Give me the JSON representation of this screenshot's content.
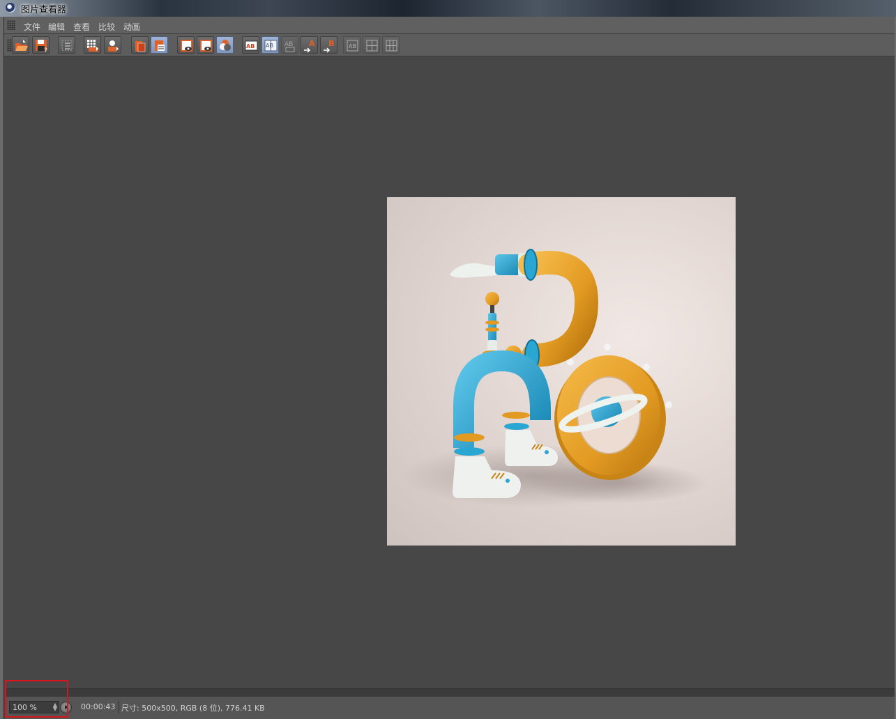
{
  "window": {
    "title": "图片查看器"
  },
  "menu": {
    "items": [
      "文件",
      "编辑",
      "查看",
      "比较",
      "动画"
    ]
  },
  "toolbar": {
    "buttons": [
      {
        "name": "open-file-icon",
        "state": "normal"
      },
      {
        "name": "save-file-icon",
        "state": "normal"
      },
      {
        "name": "filter-icon",
        "state": "normal"
      },
      {
        "name": "grid-export-icon",
        "state": "normal"
      },
      {
        "name": "user-export-icon",
        "state": "normal"
      },
      {
        "name": "copy-layer-icon",
        "state": "normal"
      },
      {
        "name": "layer-stack-icon",
        "state": "active"
      },
      {
        "name": "view-a-icon",
        "state": "normal"
      },
      {
        "name": "view-b-icon",
        "state": "normal"
      },
      {
        "name": "channels-icon",
        "state": "active"
      },
      {
        "name": "ab-compare-icon",
        "state": "normal"
      },
      {
        "name": "ab-split-icon",
        "state": "active"
      },
      {
        "name": "ab-swap-icon",
        "state": "dim"
      },
      {
        "name": "set-a-icon",
        "state": "normal",
        "label": "A"
      },
      {
        "name": "set-b-icon",
        "state": "normal",
        "label": "B"
      },
      {
        "name": "layout-one-icon",
        "state": "dim"
      },
      {
        "name": "layout-two-icon",
        "state": "dim"
      },
      {
        "name": "layout-four-icon",
        "state": "dim"
      }
    ],
    "accent_color": "#e0602a",
    "active_color": "#8ea3c9"
  },
  "viewer": {
    "image_description_visible": false
  },
  "status": {
    "zoom": "100 %",
    "time": "00:00:43",
    "info": "尺寸: 500x500, RGB (8 位), 776.41 KB"
  },
  "colors": {
    "background": "#474747",
    "highlight_box": "#d9141c"
  }
}
